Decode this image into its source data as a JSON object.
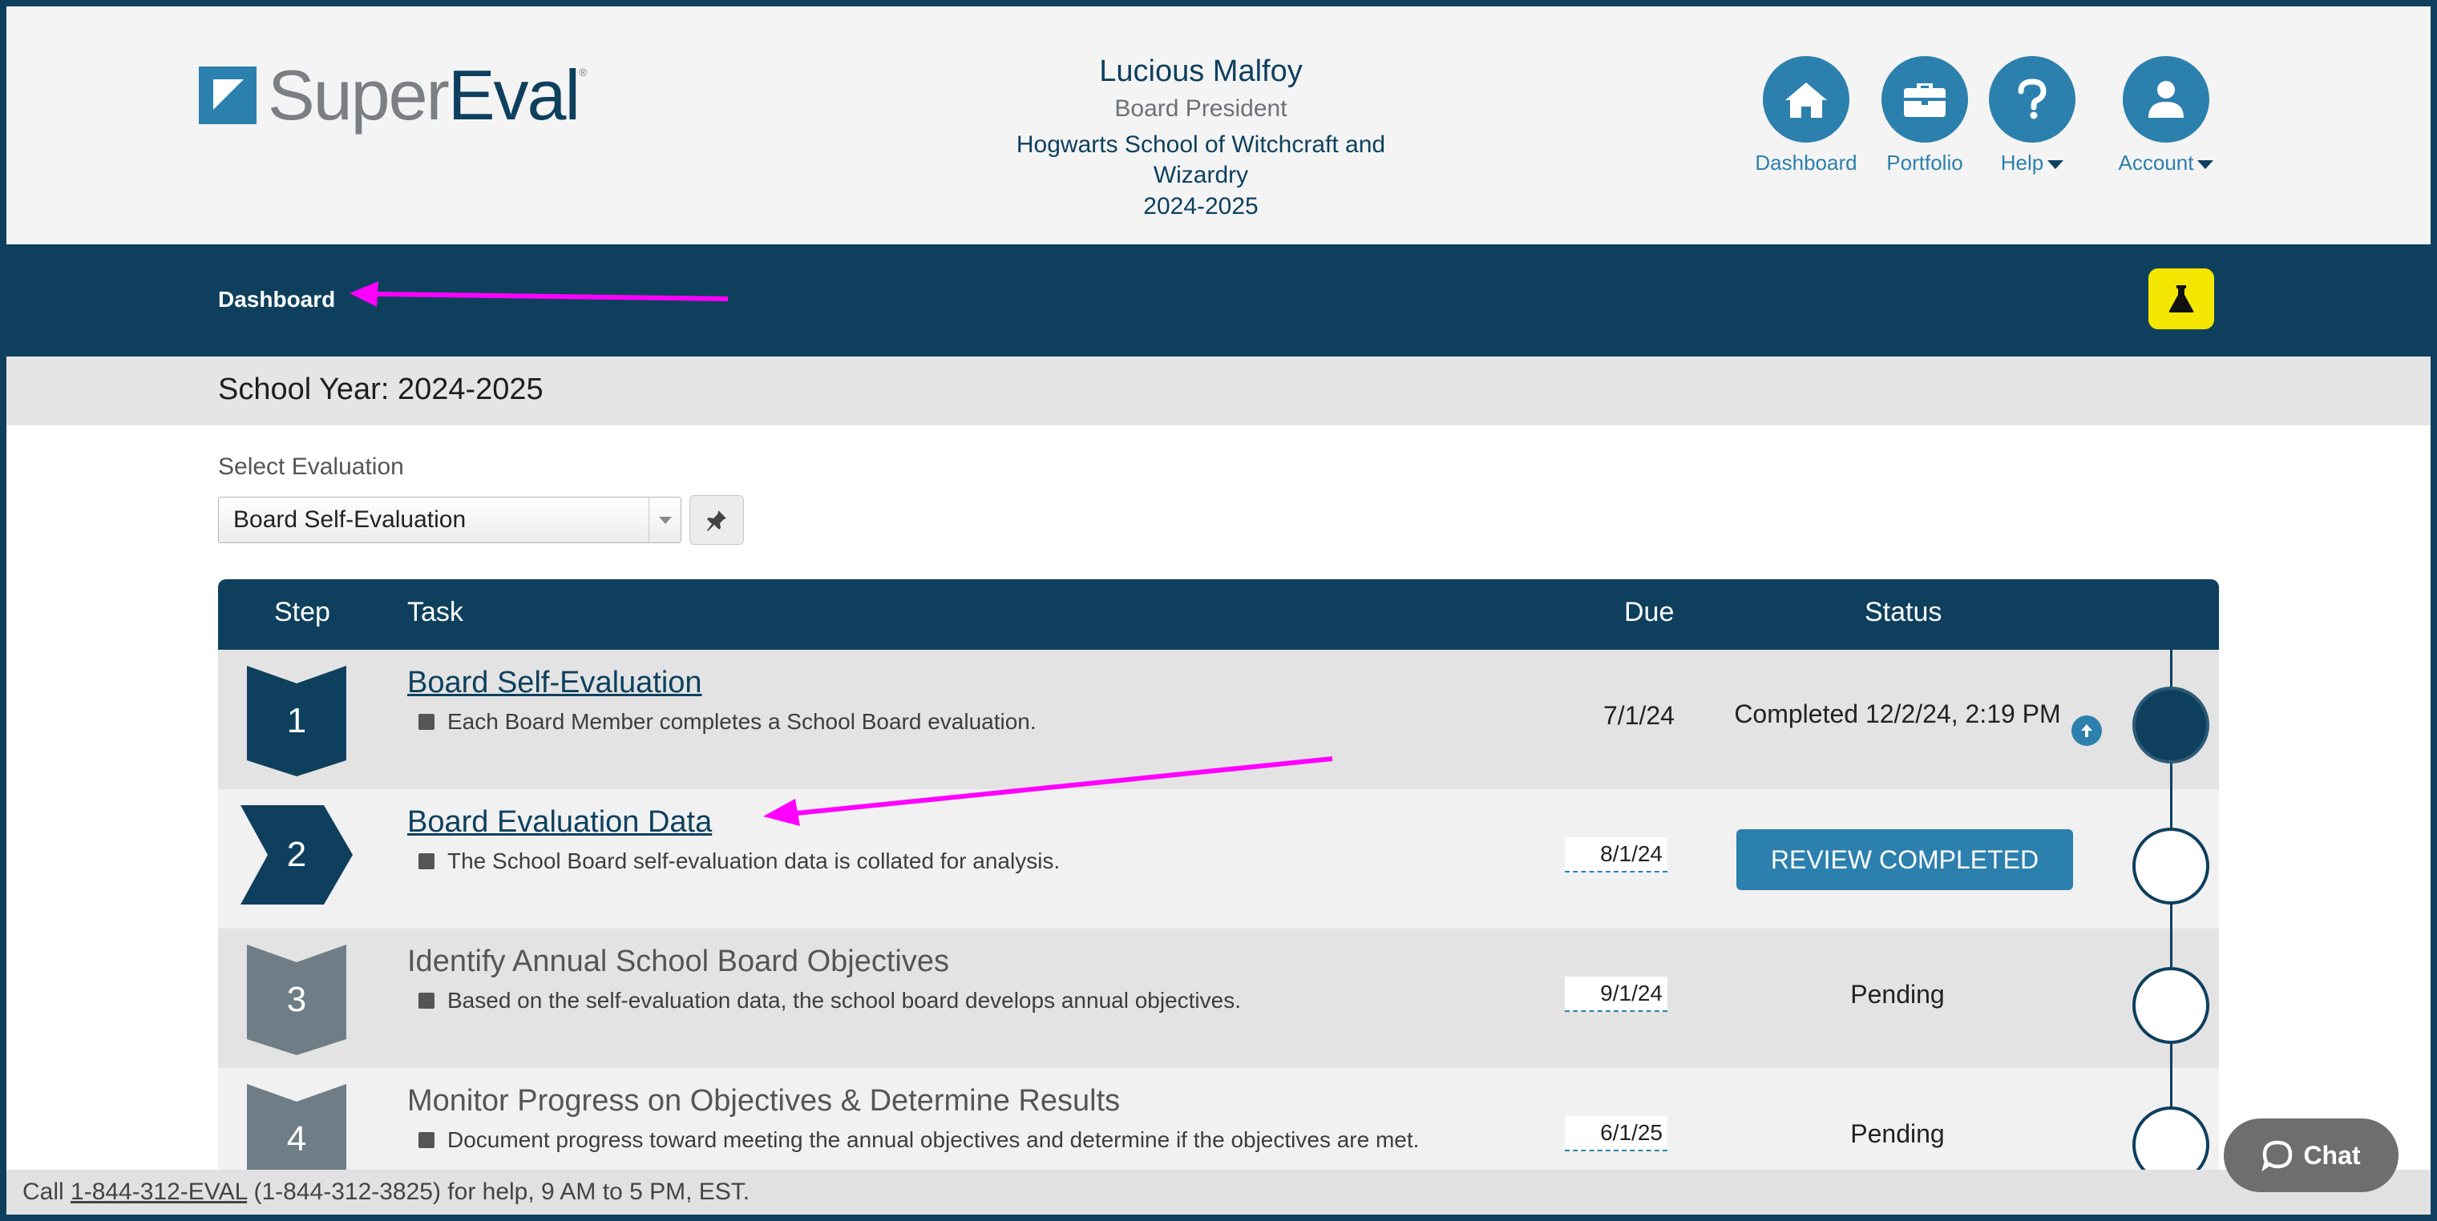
{
  "app": {
    "logo_text_a": "Super",
    "logo_text_b": "Eval",
    "logo_reg": "®"
  },
  "user": {
    "name": "Lucious Malfoy",
    "role": "Board President",
    "school": "Hogwarts School of Witchcraft and Wizardry",
    "year": "2024-2025"
  },
  "nav": {
    "dashboard": "Dashboard",
    "portfolio": "Portfolio",
    "help": "Help",
    "account": "Account"
  },
  "breadcrumb": "Dashboard",
  "school_year": "School Year: 2024-2025",
  "evaluation": {
    "label": "Select Evaluation",
    "selected": "Board Self-Evaluation"
  },
  "table": {
    "headers": {
      "step": "Step",
      "task": "Task",
      "due": "Due",
      "status": "Status"
    },
    "rows": [
      {
        "step": "1",
        "title": "Board Self-Evaluation",
        "desc": "Each Board Member completes a School Board evaluation.",
        "due": "7/1/24",
        "status": "Completed 12/2/24, 2:19 PM"
      },
      {
        "step": "2",
        "title": "Board Evaluation Data",
        "desc": "The School Board self-evaluation data is collated for analysis.",
        "due": "8/1/24",
        "status": "REVIEW COMPLETED"
      },
      {
        "step": "3",
        "title": "Identify Annual School Board Objectives",
        "desc": "Based on the self-evaluation data, the school board develops annual objectives.",
        "due": "9/1/24",
        "status": "Pending"
      },
      {
        "step": "4",
        "title": "Monitor Progress on Objectives & Determine Results",
        "desc": "Document progress toward meeting the annual objectives and determine if the objectives are met.",
        "due": "6/1/25",
        "status": "Pending"
      }
    ]
  },
  "footer": {
    "prefix": "Call ",
    "phone_link": "1-844-312-EVAL",
    "suffix": " (1-844-312-3825) for help, 9 AM to 5 PM, EST."
  },
  "chat": {
    "label": "Chat"
  },
  "colors": {
    "navy": "#0e405e",
    "accent": "#2c80ad",
    "annotation": "#ff00ff",
    "flask_bg": "#f5e600"
  }
}
